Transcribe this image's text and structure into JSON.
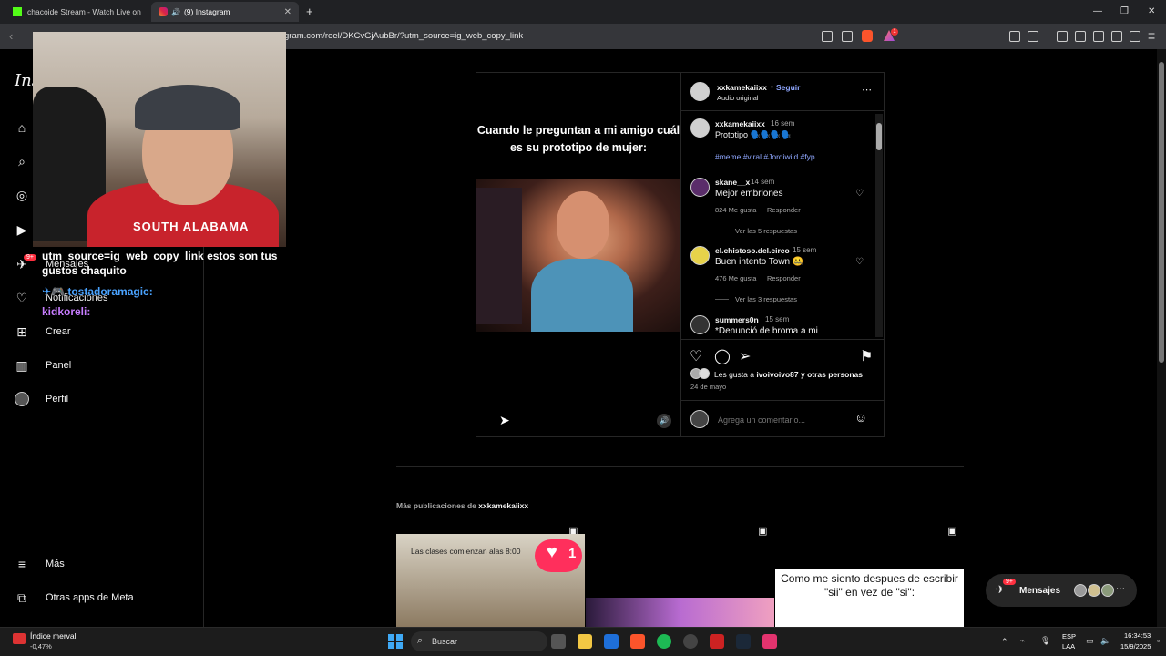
{
  "browser": {
    "tabs": [
      {
        "label": "chacoide Stream - Watch Live on"
      },
      {
        "label": "(9) Instagram"
      }
    ],
    "url": "gram.com/reel/DKCvGjAubBr/?utm_source=ig_web_copy_link",
    "new_tab": "+",
    "badge": "1"
  },
  "sidebar": {
    "logo": "Ins",
    "items": [
      {
        "label": "Mensajes",
        "badge": "9+"
      },
      {
        "label": "Notificaciones"
      },
      {
        "label": "Crear"
      },
      {
        "label": "Panel"
      },
      {
        "label": "Perfil"
      },
      {
        "label": "Más"
      },
      {
        "label": "Otras apps de Meta"
      }
    ]
  },
  "stream": {
    "shirt_text": "SOUTH ALABAMA",
    "chat": [
      {
        "text": "utm_source=ig_web_copy_link estos son tus gustos chaquito"
      },
      {
        "user": "tostadoramagic:",
        "text": ""
      },
      {
        "user": "kidkoreli:",
        "text": ""
      }
    ]
  },
  "post": {
    "video_caption": "Cuando le preguntan a mi amigo cuál es su prototipo de mujer:",
    "author": "xxkamekaiixx",
    "follow": "Seguir",
    "audio": "Audio original",
    "caption": {
      "user": "xxkamekaiixx",
      "time": "16 sem",
      "text": "Prototipo 🗣️🗣️🗣️🗣️",
      "tags": "#meme #viral #Jordiwild #fyp"
    },
    "comments": [
      {
        "user": "skane__x",
        "time": "14 sem",
        "text": "Mejor embriones",
        "likes": "824 Me gusta",
        "reply": "Responder",
        "replies": "Ver las 5 respuestas"
      },
      {
        "user": "el.chistoso.del.circo",
        "time": "15 sem",
        "text": "Buen intento Town 🤐",
        "likes": "476 Me gusta",
        "reply": "Responder",
        "replies": "Ver las 3 respuestas"
      },
      {
        "user": "summers0n_",
        "time": "15 sem",
        "text": "*Denunció de broma a mi"
      }
    ],
    "likes_prefix": "Les gusta a ",
    "likes_user": "ivoivoivo87",
    "likes_suffix": " y otras personas",
    "date": "24 de mayo",
    "comment_placeholder": "Agrega un comentario..."
  },
  "more": {
    "heading_prefix": "Más publicaciones de ",
    "heading_user": "xxkamekaiixx",
    "thumb1_text": "Las clases comienzan alas 8:00",
    "thumb1_likes": "1",
    "thumb3_text": "Como me siento despues de escribir \"sii\" en vez de \"si\":"
  },
  "messages_pill": {
    "label": "Mensajes",
    "badge": "9+"
  },
  "taskbar": {
    "ticker_name": "Índice merval",
    "ticker_value": "-0,47%",
    "search": "Buscar",
    "lang1": "ESP",
    "lang2": "LAA",
    "time": "16:34:53",
    "date": "15/9/2025"
  }
}
